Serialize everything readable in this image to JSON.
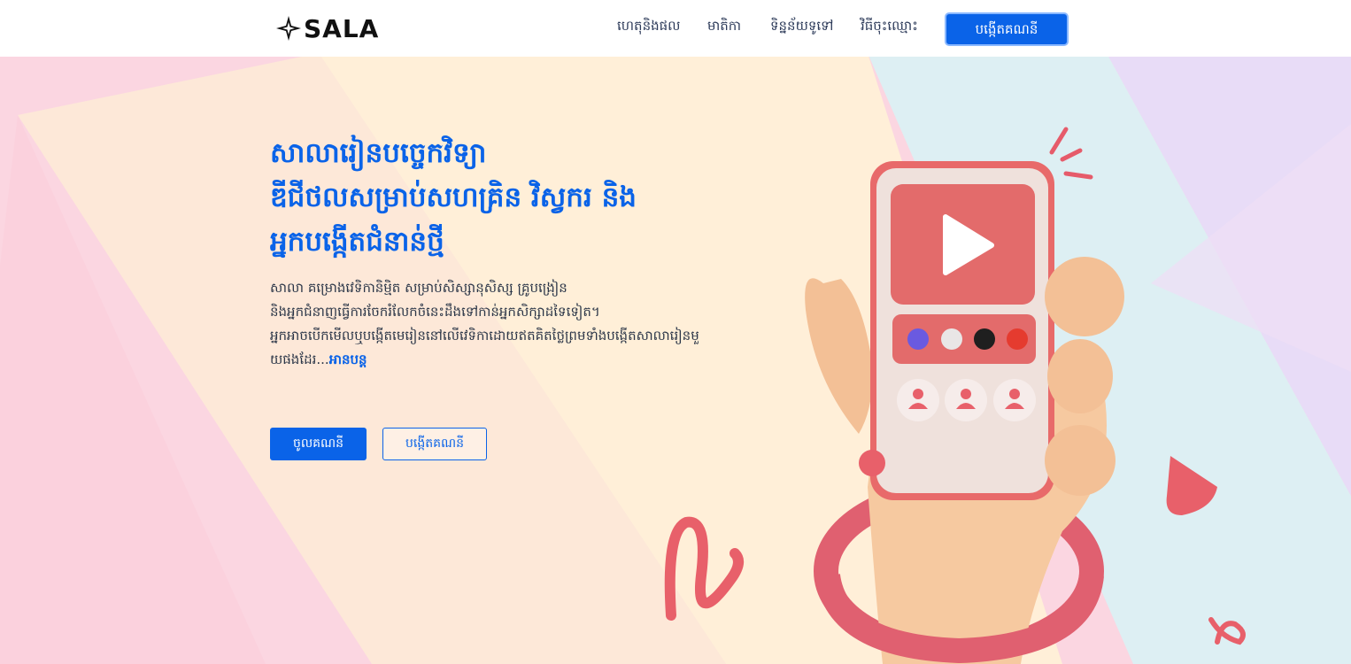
{
  "brand": {
    "name": "SALA"
  },
  "nav": {
    "items": [
      "ហេតុនិងផល",
      "មាតិកា",
      "ទិន្នន័យទូទៅ",
      "វិធីចុះឈ្មោះ"
    ],
    "signup_label": "បង្កើតគណនី"
  },
  "hero": {
    "title_lines": [
      "សាលារៀនបច្ចេកវិទ្យា",
      "ឌីជីថលសម្រាប់សហគ្រិន វិស្វករ និង",
      "អ្នកបង្កើតជំនាន់ថ្មី"
    ],
    "description_lines": [
      "សាលា គម្រោងវេទិកានិម្មិត សម្រាប់សិស្សានុសិស្ស គ្រូបង្រៀន",
      "និងអ្នកជំនាញធ្វើការចែករំលែកចំនេះដឹងទៅកាន់អ្នកសិក្សាដទៃទៀត។",
      "អ្នកអាចបើកមើលឬបង្កើតមេរៀននៅលើវេទិកាដោយឥតគិតថ្លៃព្រមទាំងបង្កើតសាលារៀនមួ",
      "យផងដែរ..."
    ],
    "read_more": "អានបន្ត",
    "login_button": "ចូលគណនី",
    "create_button": "បង្កើតគណនី"
  },
  "colors": {
    "accent": "#0a63e8",
    "text": "#2b3648",
    "phone_red": "#e86a6a",
    "skin": "#f6c9a0"
  },
  "illustration": {
    "icons": [
      "play-icon",
      "user-icon"
    ],
    "dot_colors": [
      "#6a5ae0",
      "#e9e6e6",
      "#1f1f1f",
      "#e53b2f"
    ]
  }
}
